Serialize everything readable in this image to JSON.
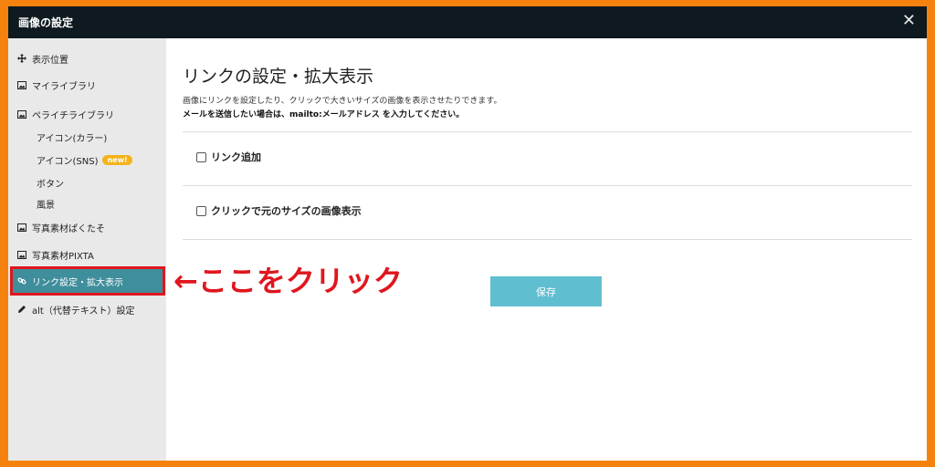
{
  "window": {
    "title": "画像の設定",
    "close_label": "✕"
  },
  "sidebar": {
    "items": [
      {
        "label": "表示位置"
      },
      {
        "label": "マイライブラリ"
      },
      {
        "label": "ペライチライブラリ"
      },
      {
        "label": "アイコン(カラー)"
      },
      {
        "label": "アイコン(SNS)",
        "badge": "new!"
      },
      {
        "label": "ボタン"
      },
      {
        "label": "風景"
      },
      {
        "label": "写真素材ぱくたそ"
      },
      {
        "label": "写真素材PIXTA"
      },
      {
        "label": "リンク設定・拡大表示"
      },
      {
        "label": "alt（代替テキスト）設定"
      }
    ]
  },
  "main": {
    "title": "リンクの設定・拡大表示",
    "description": "画像にリンクを設定したり、クリックで大きいサイズの画像を表示させたりできます。",
    "note": "メールを送信したい場合は、mailto:メールアドレス を入力してください。",
    "options": [
      {
        "label": "リンク追加",
        "checked": false
      },
      {
        "label": "クリックで元のサイズの画像表示",
        "checked": false
      }
    ],
    "save_label": "保存"
  },
  "annotation": {
    "text": "←ここをクリック"
  },
  "colors": {
    "frame": "#f5820f",
    "titlebar": "#0e1a1f",
    "active_item": "#3f8e9c",
    "highlight": "#e0161d",
    "save_button": "#5fbfd1",
    "badge": "#f5b31a"
  }
}
